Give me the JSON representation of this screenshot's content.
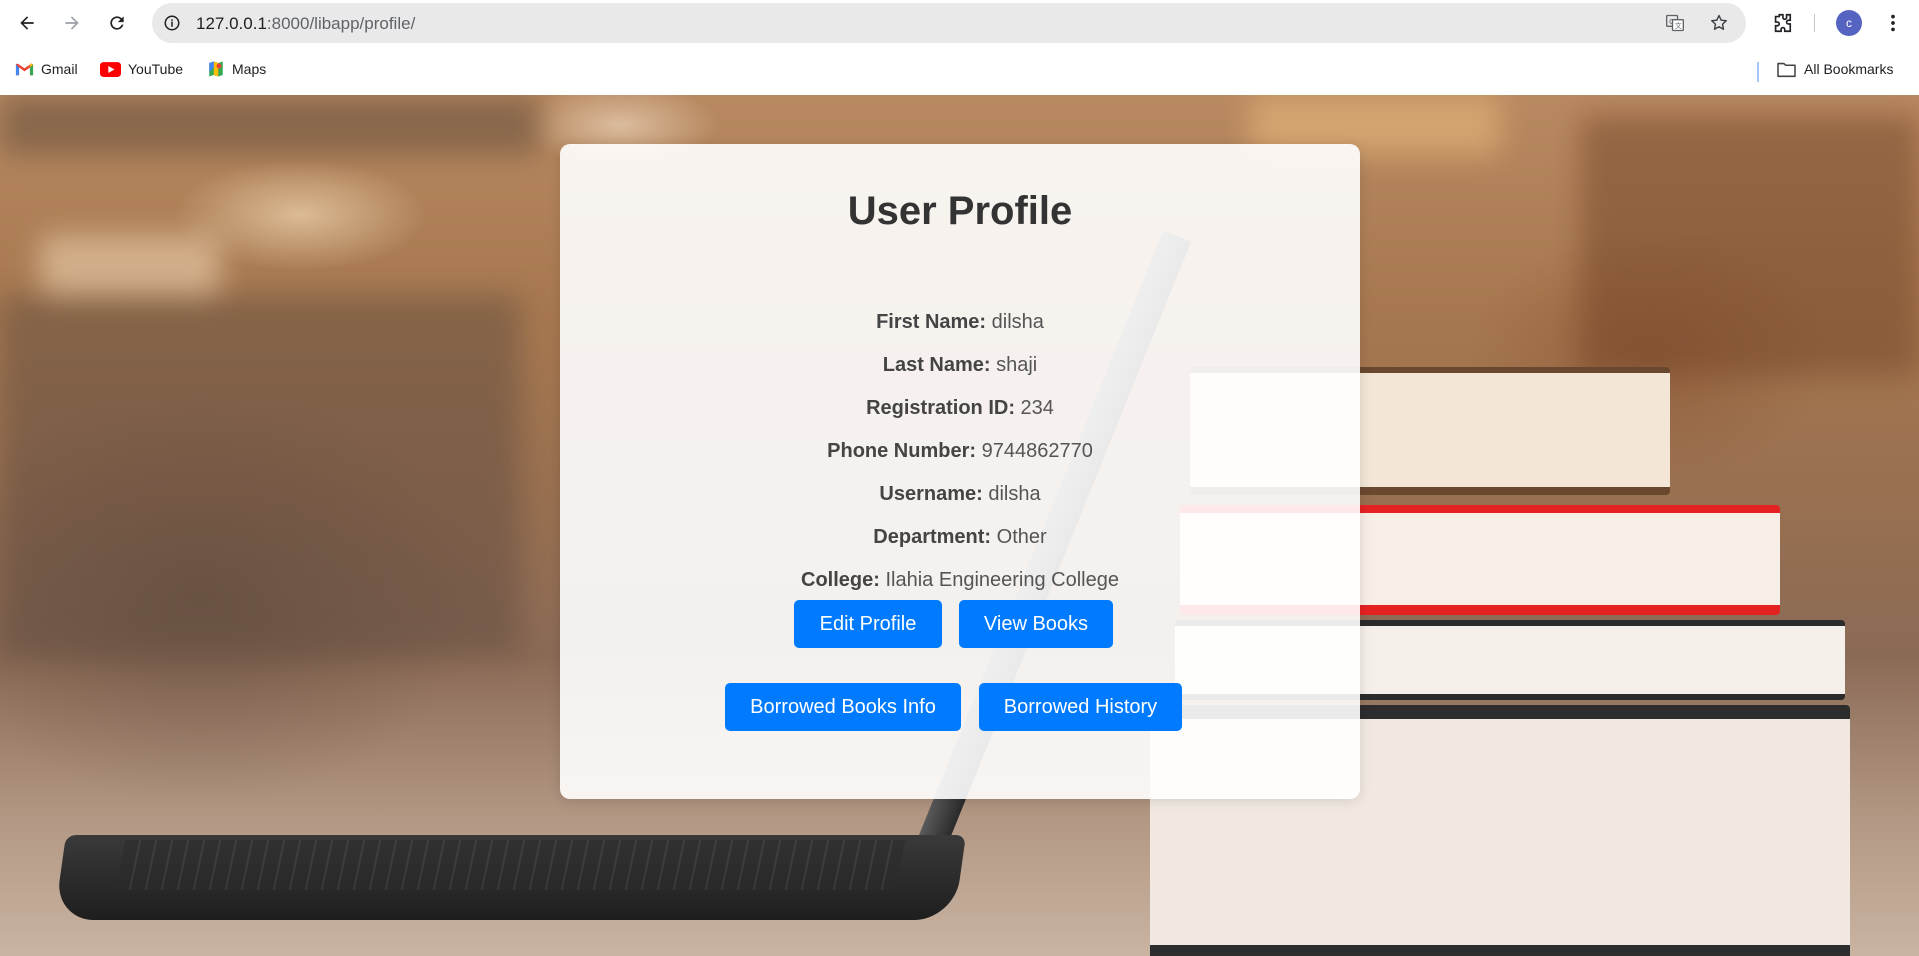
{
  "browser": {
    "url_host": "127.0.0.1",
    "url_path": ":8000/libapp/profile/",
    "avatar_letter": "c",
    "bookmarks": [
      {
        "label": "Gmail",
        "icon": "gmail-icon"
      },
      {
        "label": "YouTube",
        "icon": "youtube-icon"
      },
      {
        "label": "Maps",
        "icon": "maps-icon"
      }
    ],
    "all_bookmarks_label": "All Bookmarks"
  },
  "profile": {
    "title": "User Profile",
    "fields": [
      {
        "label": "First Name:",
        "value": "dilsha"
      },
      {
        "label": "Last Name:",
        "value": "shaji"
      },
      {
        "label": "Registration ID:",
        "value": "234"
      },
      {
        "label": "Phone Number:",
        "value": "9744862770"
      },
      {
        "label": "Username:",
        "value": "dilsha"
      },
      {
        "label": "Department:",
        "value": "Other"
      },
      {
        "label": "College:",
        "value": "Ilahia Engineering College"
      }
    ],
    "buttons": {
      "edit_profile": "Edit Profile",
      "view_books": "View Books",
      "borrowed_books_info": "Borrowed Books Info",
      "borrowed_history": "Borrowed History"
    }
  },
  "colors": {
    "button": "#007bff",
    "accent_avatar": "#5563c1"
  }
}
